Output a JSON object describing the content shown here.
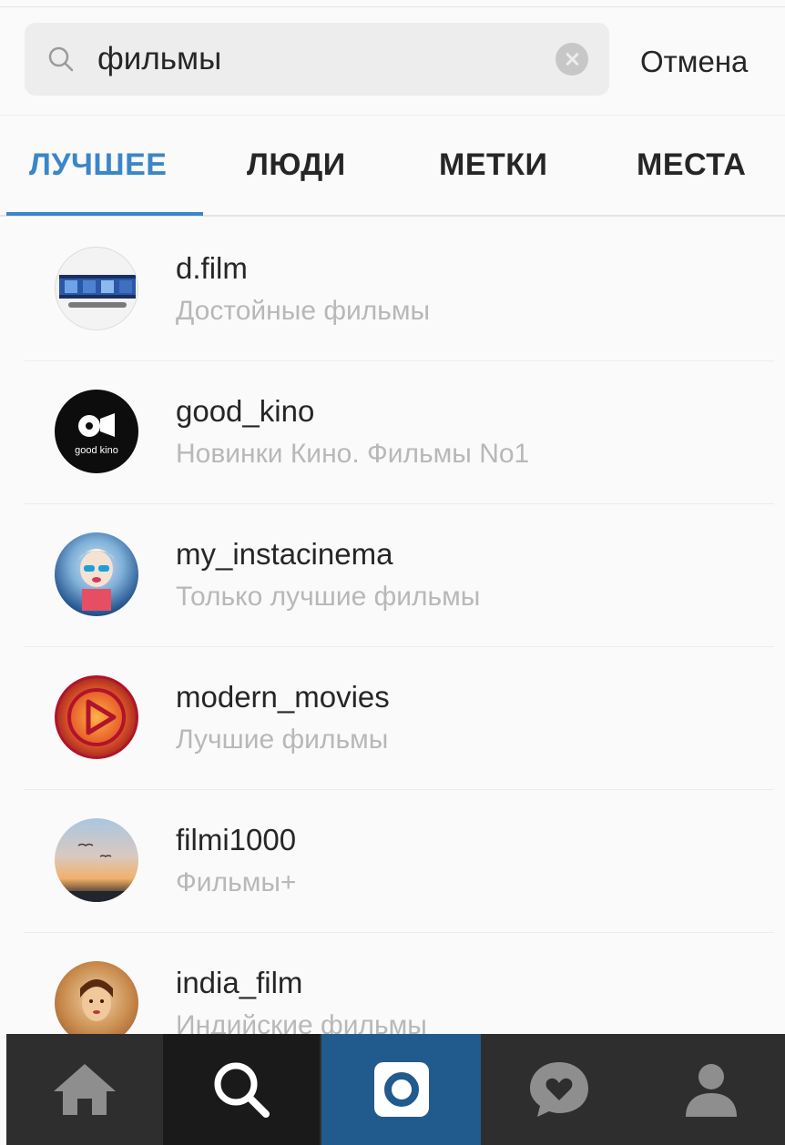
{
  "search": {
    "value": "фильмы",
    "cancel_label": "Отмена"
  },
  "tabs": [
    {
      "label": "ЛУЧШЕЕ",
      "active": true
    },
    {
      "label": "ЛЮДИ",
      "active": false
    },
    {
      "label": "МЕТКИ",
      "active": false
    },
    {
      "label": "МЕСТА",
      "active": false
    }
  ],
  "results": [
    {
      "username": "d.film",
      "fullname": "Достойные фильмы"
    },
    {
      "username": "good_kino",
      "fullname": "Новинки Кино. Фильмы No1"
    },
    {
      "username": "my_instacinema",
      "fullname": "Только лучшие фильмы"
    },
    {
      "username": "modern_movies",
      "fullname": "Лучшие фильмы"
    },
    {
      "username": "filmi1000",
      "fullname": "Фильмы+"
    },
    {
      "username": "india_film",
      "fullname": "Индийские фильмы"
    }
  ],
  "avatar_text": {
    "good_kino": "good kino"
  },
  "colors": {
    "accent": "#3b86c8",
    "tabbar_bg": "#2e2e2e",
    "tabbar_active": "#215b8e",
    "secondary_text": "#b8b8b8"
  },
  "tabbar": [
    "home-icon",
    "search-icon",
    "camera-icon",
    "activity-icon",
    "profile-icon"
  ]
}
